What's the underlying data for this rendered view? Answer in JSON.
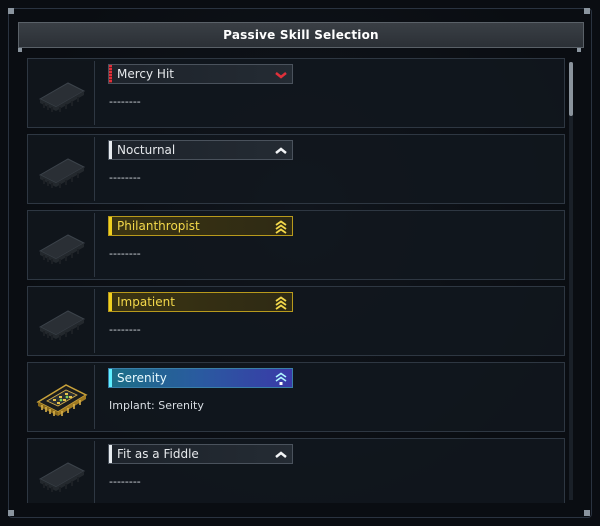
{
  "window": {
    "title": "Passive Skill Selection"
  },
  "skills": [
    {
      "name": "Mercy Hit",
      "description": "--------",
      "rarity_icon": "chevron-down-icon",
      "style": "red"
    },
    {
      "name": "Nocturnal",
      "description": "--------",
      "rarity_icon": "chevron-up-icon",
      "style": "white"
    },
    {
      "name": "Philanthropist",
      "description": "--------",
      "rarity_icon": "triple-chevron-up-icon",
      "style": "gold"
    },
    {
      "name": "Impatient",
      "description": "--------",
      "rarity_icon": "triple-chevron-up-icon",
      "style": "gold"
    },
    {
      "name": "Serenity",
      "description": "Implant: Serenity",
      "rarity_icon": "rarity-gem-icon",
      "style": "teal"
    },
    {
      "name": "Fit as a Fiddle",
      "description": "--------",
      "rarity_icon": "chevron-up-icon",
      "style": "white"
    }
  ],
  "colors": {
    "red_accent": "#e0303a",
    "gold_accent": "#f0d020",
    "teal_accent": "#5ff0ff",
    "background": "#0a0d12"
  }
}
